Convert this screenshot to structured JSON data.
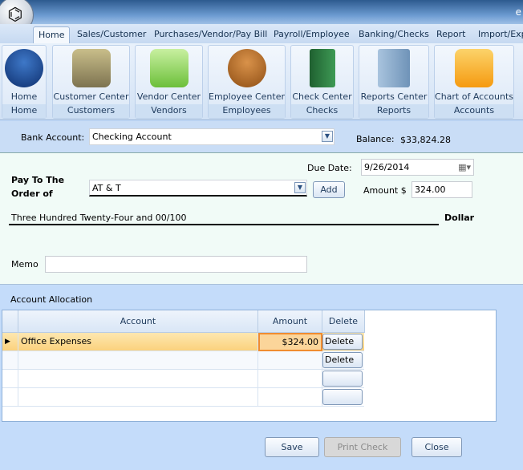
{
  "title_fragment": "e",
  "tabs": [
    "Home",
    "Sales/Customer",
    "Purchases/Vendor/Pay Bill",
    "Payroll/Employee",
    "Banking/Checks",
    "Report",
    "Import/Exp"
  ],
  "ribbon": [
    {
      "label": "Home",
      "group": "Home",
      "icon": "home-icon",
      "color": "#1f4f9a"
    },
    {
      "label": "Customer Center",
      "group": "Customers",
      "icon": "customer-folder-icon",
      "color": "#a59a6a"
    },
    {
      "label": "Vendor Center",
      "group": "Vendors",
      "icon": "vendor-book-icon",
      "color": "#8fcf5a"
    },
    {
      "label": "Employee Center",
      "group": "Employees",
      "icon": "employees-icon",
      "color": "#b06a25"
    },
    {
      "label": "Check Center",
      "group": "Checks",
      "icon": "checkbook-icon",
      "color": "#2e7d3e"
    },
    {
      "label": "Reports Center",
      "group": "Reports",
      "icon": "reports-binder-icon",
      "color": "#8fb0d0"
    },
    {
      "label": "Chart of Accounts",
      "group": "Accounts",
      "icon": "accounts-folder-icon",
      "color": "#f7a520"
    }
  ],
  "bank": {
    "label": "Bank Account:",
    "value": "Checking Account",
    "balance_label": "Balance:",
    "balance": "$33,824.28"
  },
  "check": {
    "due_label": "Due Date:",
    "due": "9/26/2014",
    "pay_label_1": "Pay To The",
    "pay_label_2": "Order of",
    "payee": "AT & T",
    "add": "Add",
    "amount_label": "Amount $",
    "amount": "324.00",
    "words": "Three Hundred Twenty-Four and 00/100",
    "dollar": "Dollar",
    "memo_label": "Memo",
    "memo": ""
  },
  "allocation": {
    "title": "Account Allocation",
    "headers": [
      "Account",
      "Amount",
      "Delete"
    ],
    "rows": [
      {
        "account": "Office Expenses",
        "amount": "$324.00",
        "delete": "Delete"
      },
      {
        "account": "",
        "amount": "",
        "delete": "Delete"
      },
      {
        "account": "",
        "amount": "",
        "delete": ""
      },
      {
        "account": "",
        "amount": "",
        "delete": ""
      }
    ]
  },
  "buttons": {
    "save": "Save",
    "print": "Print Check",
    "close": "Close"
  }
}
